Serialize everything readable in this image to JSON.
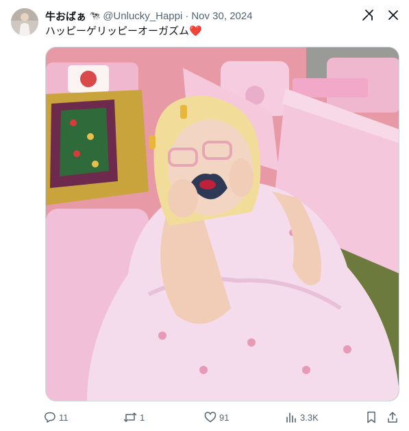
{
  "author": {
    "display_name": "牛おばぁ",
    "name_emoji": "🐄",
    "handle": "@Unlucky_Happi",
    "separator": "·",
    "date": "Nov 30, 2024"
  },
  "tweet": {
    "text": "ハッピーゲリッピーオーガズム",
    "heart_emoji": "❤️"
  },
  "top_icons": [
    "grok-icon",
    "close-icon"
  ],
  "actions": {
    "replies": "11",
    "retweets": "1",
    "likes": "91",
    "views": "3.3K"
  },
  "colors": {
    "text": "#0f1419",
    "muted": "#536471",
    "heart": "#e0245e",
    "photo_wall": "#e79aa6",
    "photo_sofa": "#f2bfd8",
    "photo_carpet": "#6c7a3e"
  }
}
